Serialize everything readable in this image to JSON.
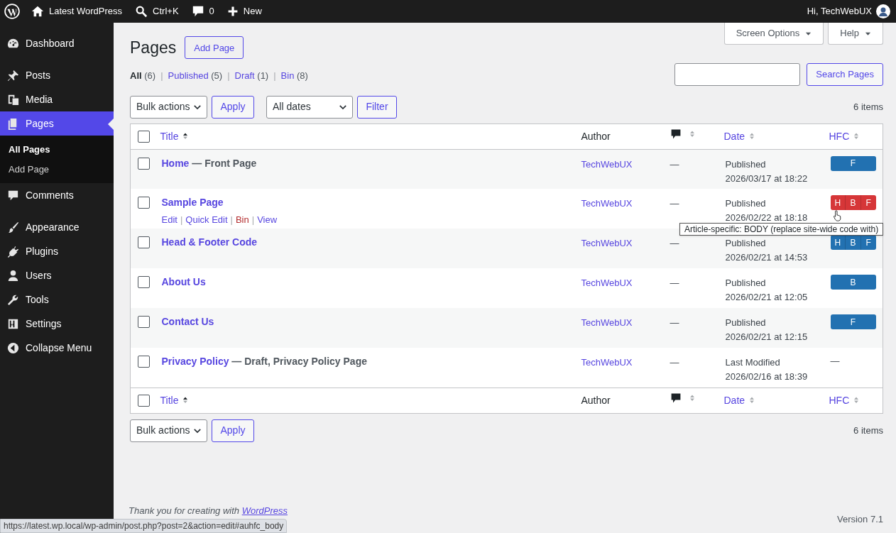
{
  "admin_bar": {
    "site": "Latest WordPress",
    "search": "Ctrl+K",
    "comments": "0",
    "new": "New",
    "greeting": "Hi, TechWebUX"
  },
  "sidebar": {
    "items": [
      {
        "label": "Dashboard",
        "selected": false
      },
      {
        "label": "Posts",
        "selected": false
      },
      {
        "label": "Media",
        "selected": false
      },
      {
        "label": "Pages",
        "selected": true,
        "children": [
          {
            "label": "All Pages",
            "selected": true
          },
          {
            "label": "Add Page",
            "selected": false
          }
        ]
      },
      {
        "label": "Comments",
        "selected": false
      },
      {
        "label": "Appearance",
        "selected": false
      },
      {
        "label": "Plugins",
        "selected": false
      },
      {
        "label": "Users",
        "selected": false
      },
      {
        "label": "Tools",
        "selected": false
      },
      {
        "label": "Settings",
        "selected": false
      },
      {
        "label": "Collapse Menu",
        "selected": false
      }
    ]
  },
  "header": {
    "title": "Pages",
    "add_button": "Add Page",
    "screen_options": "Screen Options",
    "help": "Help"
  },
  "views": [
    {
      "label": "All",
      "count": "(6)",
      "selected": true
    },
    {
      "separator": "|",
      "label": "Published",
      "count": "(5)",
      "selected": false
    },
    {
      "separator": "|",
      "label": "Draft",
      "count": "(1)",
      "selected": false
    },
    {
      "separator": "|",
      "label": "Bin",
      "count": "(8)",
      "selected": false
    }
  ],
  "search": {
    "button": "Search Pages"
  },
  "top_nav": {
    "bulk": "Bulk actions",
    "apply": "Apply",
    "dates": "All dates",
    "filter": "Filter",
    "count": "6 items"
  },
  "bottom_nav": {
    "bulk": "Bulk actions",
    "apply": "Apply",
    "count": "6 items"
  },
  "table": {
    "select_all_checked": false,
    "columns": [
      "Title",
      "Author",
      "Date",
      "HFC"
    ],
    "rows": [
      {
        "title": "Home",
        "state": " — Front Page",
        "author": "TechWebUX",
        "comments": "—",
        "status": "Published",
        "date": "2026/03/17 at 18:22",
        "hfc": {
          "segments": [
            "F"
          ],
          "hovered": false
        },
        "checked": false
      },
      {
        "title": "Sample Page",
        "actions": [
          {
            "label": "Edit"
          },
          {
            "separator": "|",
            "label": "Quick Edit"
          },
          {
            "separator": "|",
            "label": "Bin"
          },
          {
            "separator": "|",
            "label": "View"
          }
        ],
        "author": "TechWebUX",
        "comments": "—",
        "status": "Published",
        "date": "2026/02/22 at 18:18",
        "hfc": {
          "segments": [
            "H",
            "B",
            "F"
          ],
          "hovered": true
        },
        "checked": false
      },
      {
        "title": "Head & Footer Code",
        "author": "TechWebUX",
        "comments": "—",
        "status": "Published",
        "date": "2026/02/21 at 14:53",
        "hfc": {
          "segments": [
            "H",
            "B",
            "F"
          ],
          "hovered": false
        },
        "checked": false
      },
      {
        "title": "About Us",
        "author": "TechWebUX",
        "comments": "—",
        "status": "Published",
        "date": "2026/02/21 at 12:05",
        "hfc": {
          "segments": [
            "B"
          ],
          "hovered": false
        },
        "checked": false
      },
      {
        "title": "Contact Us",
        "author": "TechWebUX",
        "comments": "—",
        "status": "Published",
        "date": "2026/02/21 at 12:15",
        "hfc": {
          "segments": [
            "F"
          ],
          "hovered": false
        },
        "checked": false
      },
      {
        "title": "Privacy Policy",
        "state": " — Draft, Privacy Policy Page",
        "author": "TechWebUX",
        "comments": "—",
        "status": "Last Modified",
        "date": "2026/02/16 at 18:39",
        "hfc_empty": "—",
        "checked": false
      }
    ],
    "footer_select_all_checked": false,
    "footer_columns": [
      "Title",
      "Author",
      "Date",
      "HFC"
    ]
  },
  "tooltip": "Article-specific: BODY (replace site-wide code with)",
  "footer": {
    "thanks": "Thank you for creating with ",
    "link": "WordPress",
    "version": "Version 7.1"
  },
  "status_bar": "https://latest.wp.local/wp-admin/post.php?post=2&action=edit#auhfc_body"
}
